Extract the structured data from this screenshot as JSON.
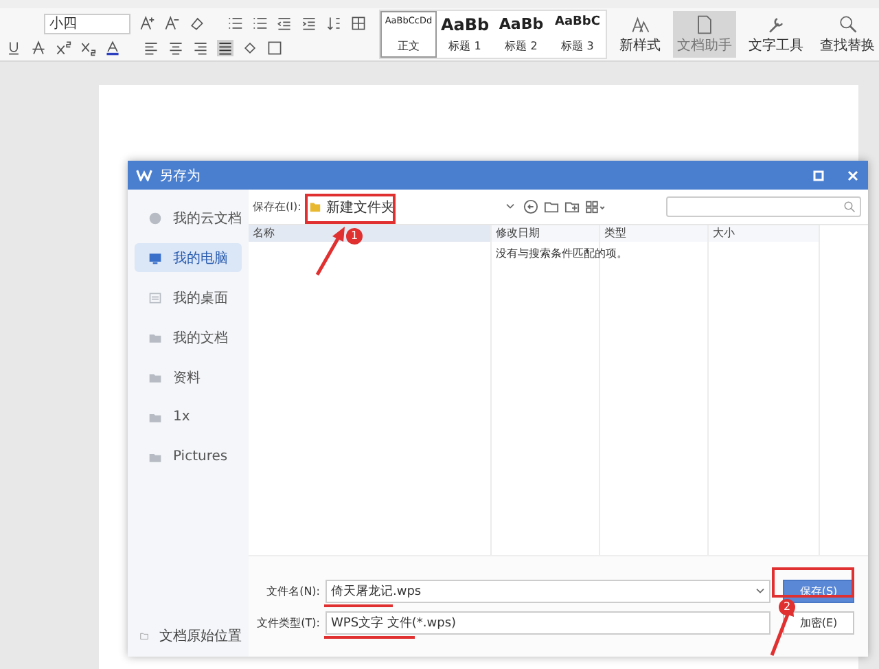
{
  "ribbon": {
    "font_size": "小四",
    "styles": [
      {
        "sample": "AaBbCcDd",
        "name": "正文",
        "selected": true
      },
      {
        "sample": "AaBb",
        "name": "标题 1",
        "selected": false
      },
      {
        "sample": "AaBb",
        "name": "标题 2",
        "selected": false
      },
      {
        "sample": "AaBbC",
        "name": "标题 3",
        "selected": false
      }
    ],
    "tools": [
      {
        "label": "新样式",
        "kind": "styles",
        "selected": false
      },
      {
        "label": "文档助手",
        "kind": "assistant",
        "selected": true
      },
      {
        "label": "文字工具",
        "kind": "wrench",
        "selected": false
      },
      {
        "label": "查找替换",
        "kind": "search",
        "selected": false
      }
    ]
  },
  "dialog": {
    "title": "另存为",
    "sidebar": [
      {
        "label": "我的云文档",
        "kind": "cloud",
        "selected": false
      },
      {
        "label": "我的电脑",
        "kind": "computer",
        "selected": true
      },
      {
        "label": "我的桌面",
        "kind": "desktop",
        "selected": false
      },
      {
        "label": "我的文档",
        "kind": "folder",
        "selected": false
      },
      {
        "label": "资料",
        "kind": "folder",
        "selected": false
      },
      {
        "label": "1x",
        "kind": "folder",
        "selected": false
      },
      {
        "label": "Pictures",
        "kind": "folder",
        "selected": false
      }
    ],
    "sidebar_footer": "文档原始位置",
    "location_label": "保存在(I):",
    "location": "新建文件夹",
    "columns": [
      "名称",
      "修改日期",
      "类型",
      "大小"
    ],
    "empty_message": "没有与搜索条件匹配的项。",
    "filename_label": "文件名(N):",
    "filename": "倚天屠龙记.wps",
    "filetype_label": "文件类型(T):",
    "filetype": "WPS文字 文件(*.wps)",
    "buttons": [
      {
        "label": "保存(S)",
        "kind": "primary"
      },
      {
        "label": "加密(E)",
        "kind": "secondary"
      }
    ]
  },
  "annotations": [
    {
      "number": "1"
    },
    {
      "number": "2"
    }
  ]
}
